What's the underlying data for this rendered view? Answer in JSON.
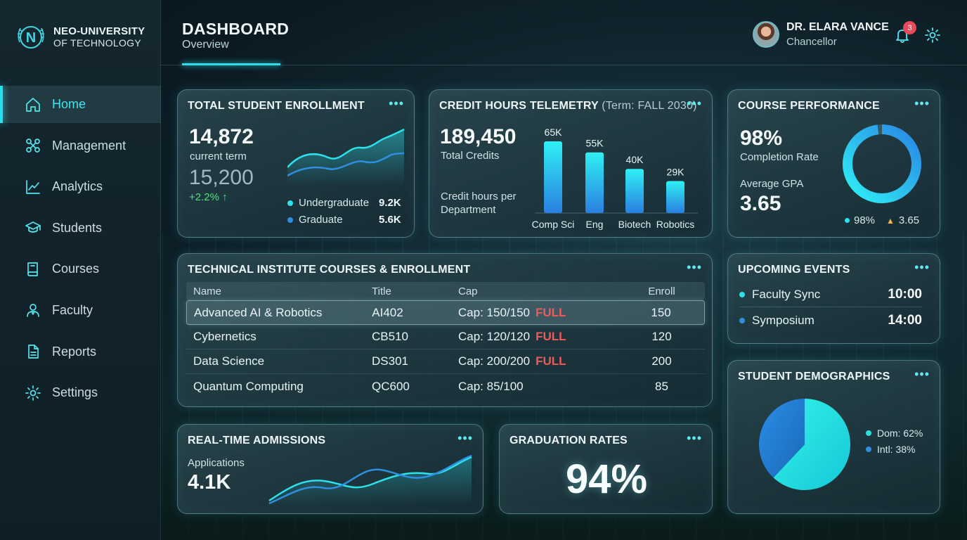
{
  "brand": {
    "name": "NEO-UNIVERSITY",
    "sub": "OF TECHNOLOGY",
    "logo_letter": "N"
  },
  "nav": {
    "items": [
      {
        "label": "Home",
        "icon": "home-icon",
        "active": true
      },
      {
        "label": "Management",
        "icon": "management-icon"
      },
      {
        "label": "Analytics",
        "icon": "analytics-icon"
      },
      {
        "label": "Students",
        "icon": "graduation-cap-icon"
      },
      {
        "label": "Courses",
        "icon": "book-icon"
      },
      {
        "label": "Faculty",
        "icon": "faculty-icon"
      },
      {
        "label": "Reports",
        "icon": "document-icon"
      },
      {
        "label": "Settings",
        "icon": "gear-icon"
      }
    ]
  },
  "header": {
    "title": "DASHBOARD",
    "subtitle": "Overview"
  },
  "user": {
    "name": "DR. ELARA VANCE",
    "role": "Chancellor",
    "notifications": "3"
  },
  "colors": {
    "accent": "#2ce0ec",
    "blue": "#2f8fe0",
    "green": "#4fe07a",
    "full": "#f05a5a"
  },
  "enrollment": {
    "title": "TOTAL STUDENT ENROLLMENT",
    "value": "14,872",
    "value_label": "current term",
    "previous": "15,200",
    "delta": "+2.2% ↑",
    "legend": [
      {
        "label": "Undergraduate",
        "value": "9.2K"
      },
      {
        "label": "Graduate",
        "value": "5.6K"
      }
    ]
  },
  "credit": {
    "title": "CREDIT HOURS TELEMETRY",
    "term": "(Term: FALL 2030)",
    "value": "189,450",
    "value_label": "Total Credits",
    "caption_line1": "Credit hours per",
    "caption_line2": "Department"
  },
  "chart_data": [
    {
      "type": "bar",
      "title": "Credit hours per Department",
      "categories": [
        "Comp Sci",
        "Eng",
        "Biotech",
        "Robotics"
      ],
      "values": [
        65000,
        55000,
        40000,
        29000
      ],
      "value_labels": [
        "65K",
        "55K",
        "40K",
        "29K"
      ],
      "ylim": [
        0,
        65000
      ]
    },
    {
      "type": "donut",
      "title": "Student Demographics",
      "categories": [
        "Dom",
        "Intl"
      ],
      "values": [
        62,
        38
      ],
      "legend_labels": [
        "Dom: 62%",
        "Intl: 38%"
      ]
    }
  ],
  "performance": {
    "title": "COURSE PERFORMANCE",
    "completion": "98%",
    "completion_label": "Completion Rate",
    "gpa_label": "Average GPA",
    "gpa": "3.65",
    "completion_fraction": 0.98,
    "legend_completion": "98%",
    "legend_gpa": "3.65"
  },
  "courses": {
    "title": "TECHNICAL INSTITUTE COURSES & ENROLLMENT",
    "headers": [
      "Name",
      "Title",
      "Cap",
      "Enroll"
    ],
    "rows": [
      {
        "name": "Advanced AI & Robotics",
        "code": "AI402",
        "cap": "Cap: 150/150",
        "full": "FULL",
        "enroll": "150"
      },
      {
        "name": "Cybernetics",
        "code": "CB510",
        "cap": "Cap: 120/120",
        "full": "FULL",
        "enroll": "120"
      },
      {
        "name": "Data Science",
        "code": "DS301",
        "cap": "Cap: 200/200",
        "full": "FULL",
        "enroll": "200"
      },
      {
        "name": "Quantum Computing",
        "code": "QC600",
        "cap": "Cap: 85/100",
        "full": "",
        "enroll": "85"
      }
    ]
  },
  "events": {
    "title": "UPCOMING EVENTS",
    "items": [
      {
        "name": "Faculty Sync",
        "time": "10:00"
      },
      {
        "name": "Symposium",
        "time": "14:00"
      }
    ]
  },
  "admissions": {
    "title": "REAL-TIME ADMISSIONS",
    "label": "Applications",
    "value": "4.1K"
  },
  "graduation": {
    "title": "GRADUATION RATES",
    "value": "94%"
  },
  "demographics": {
    "title": "STUDENT DEMOGRAPHICS"
  }
}
